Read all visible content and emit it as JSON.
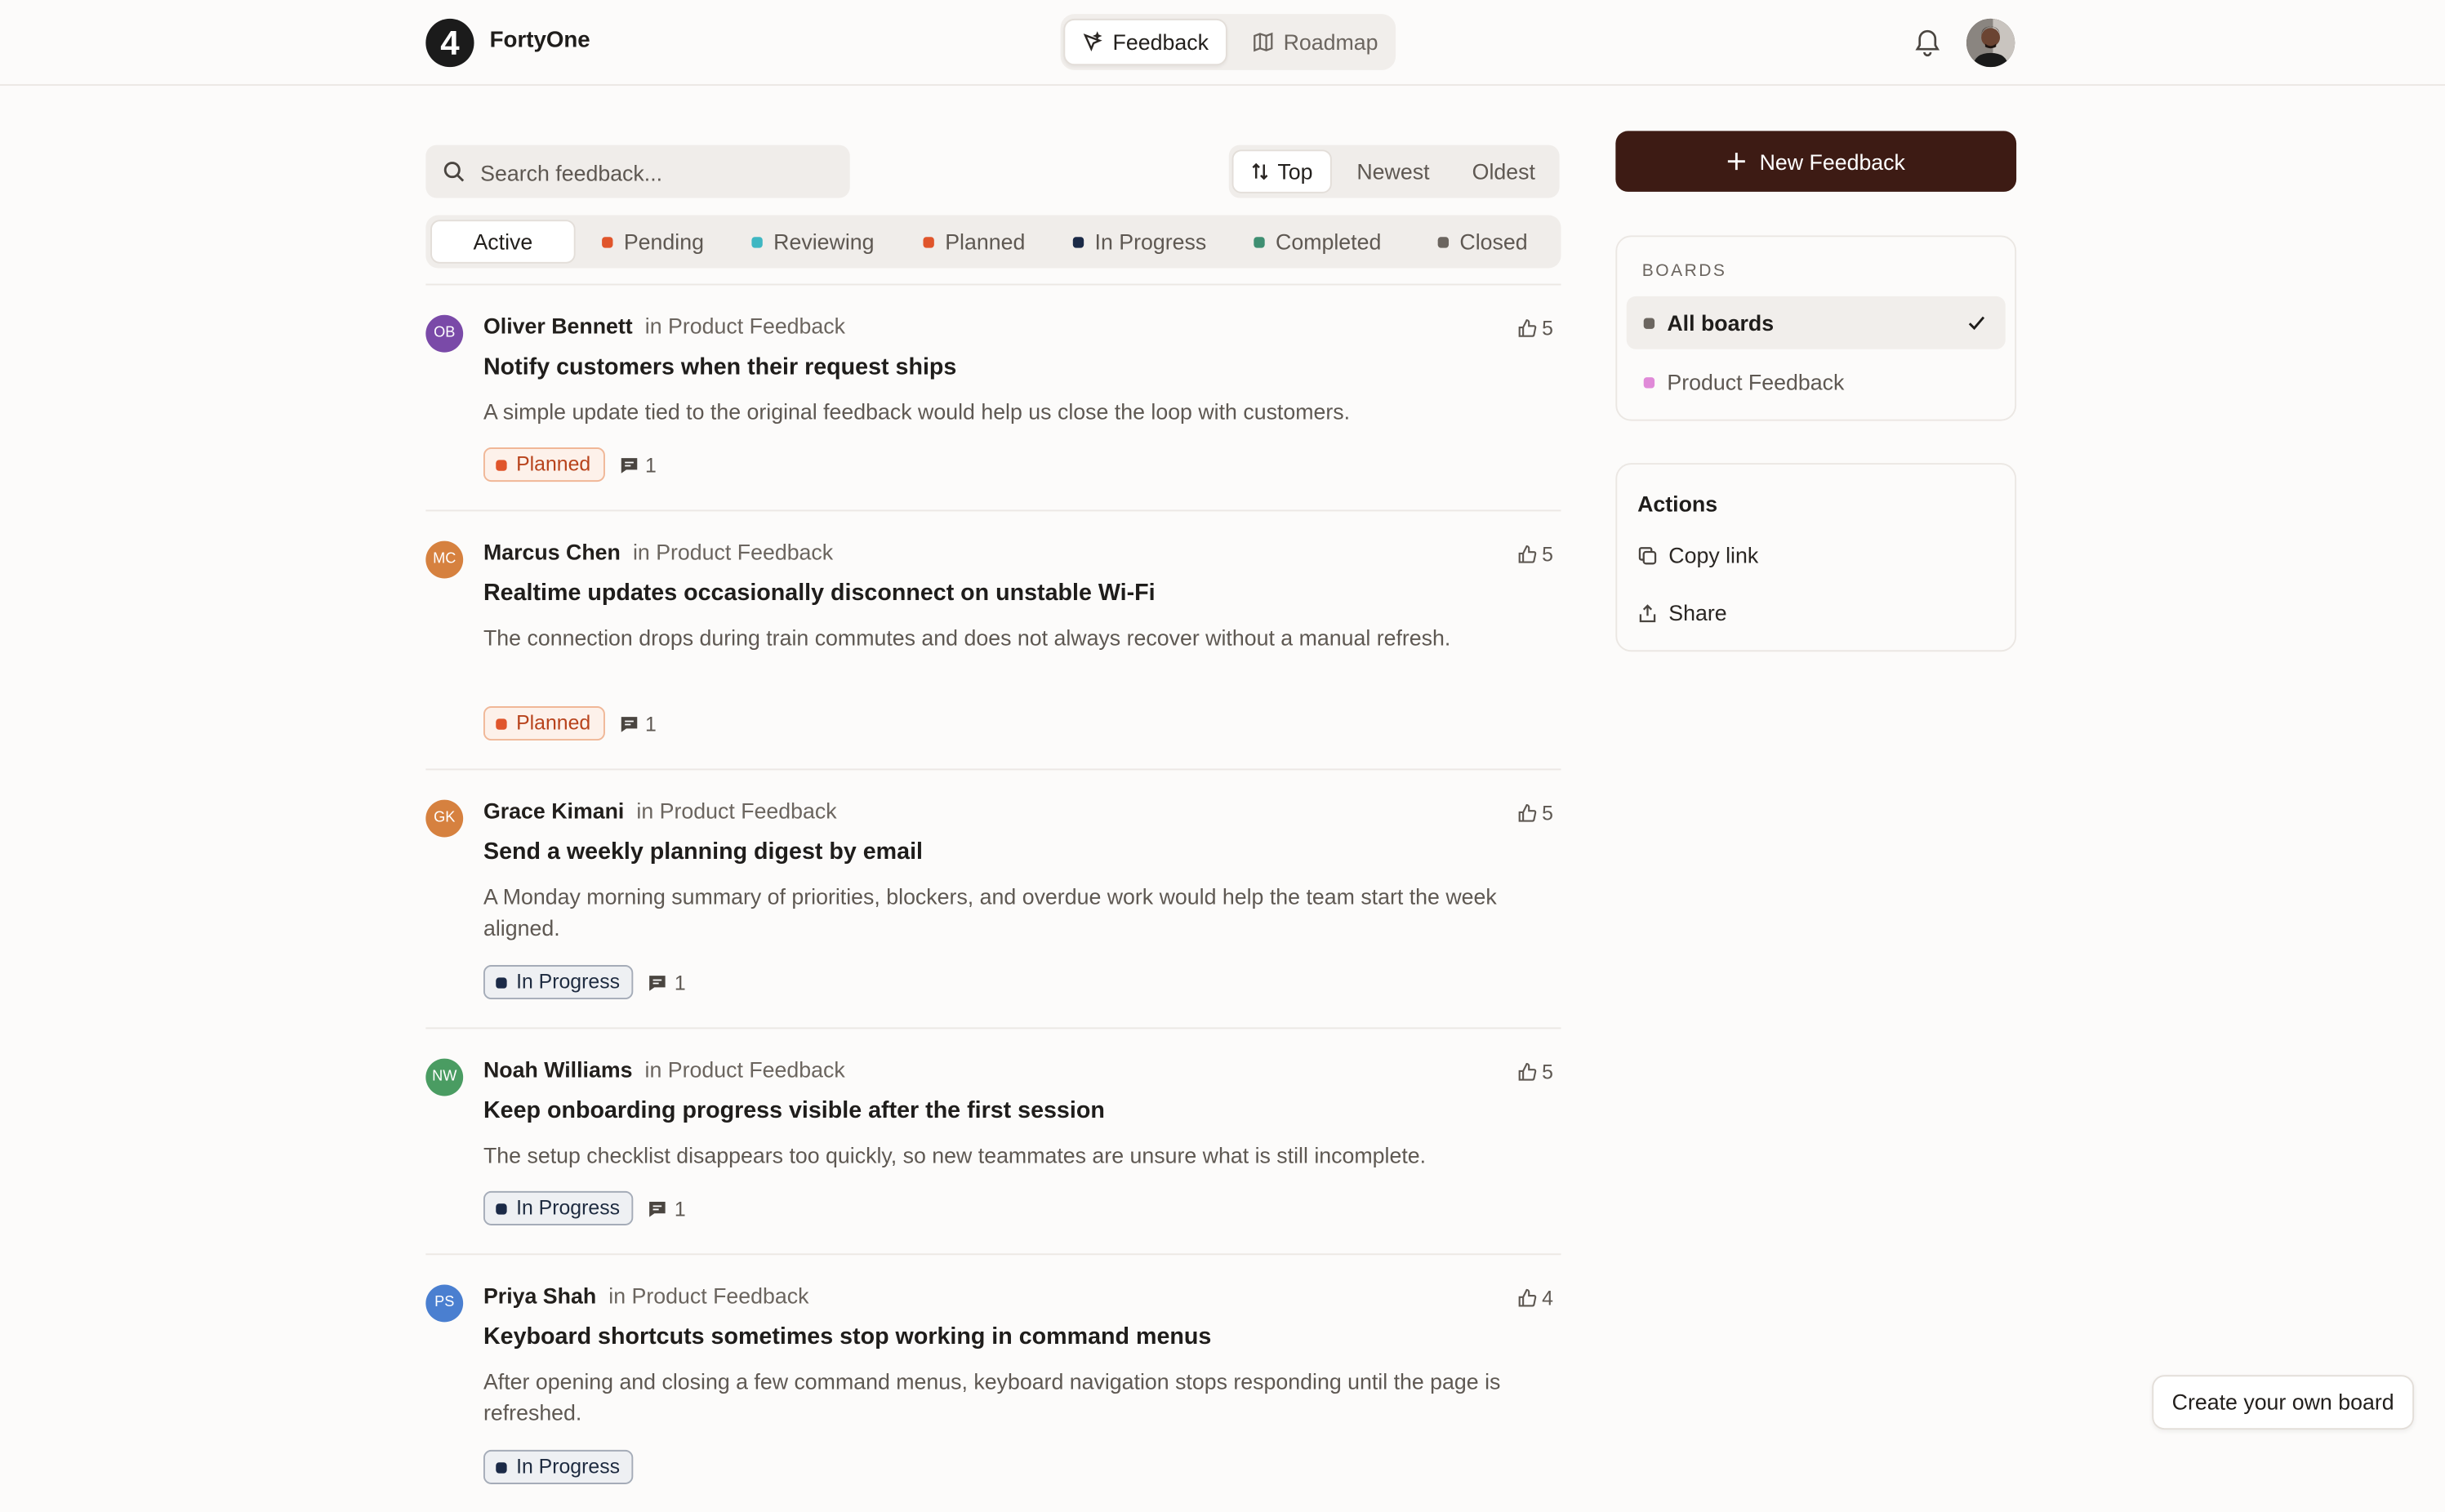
{
  "app": {
    "brand": "FortyOne",
    "logo_glyph": "4",
    "nav": [
      {
        "label": "Feedback",
        "icon": "feedback-icon",
        "active": true
      },
      {
        "label": "Roadmap",
        "icon": "map-icon",
        "active": false
      }
    ]
  },
  "search": {
    "placeholder": "Search feedback...",
    "value": ""
  },
  "sort": [
    {
      "label": "Top",
      "active": true
    },
    {
      "label": "Newest",
      "active": false
    },
    {
      "label": "Oldest",
      "active": false
    }
  ],
  "filters": [
    {
      "label": "Active",
      "color": "",
      "active": true
    },
    {
      "label": "Pending",
      "color": "#e0552b"
    },
    {
      "label": "Reviewing",
      "color": "#3fb7c2"
    },
    {
      "label": "Planned",
      "color": "#e0552b"
    },
    {
      "label": "In Progress",
      "color": "#1b2a47"
    },
    {
      "label": "Completed",
      "color": "#3f8f72"
    },
    {
      "label": "Closed",
      "color": "#6b655f"
    }
  ],
  "preposition": "in",
  "feedback": [
    {
      "initials": "OB",
      "avatar_color": "#7a4aa8",
      "author": "Oliver Bennett",
      "board": "Product Feedback",
      "votes": "5",
      "title": "Notify customers when their request ships",
      "description": "A simple update tied to the original feedback would help us close the loop with customers.",
      "status": "Planned",
      "status_color": "#e0552b",
      "comments": "1"
    },
    {
      "initials": "MC",
      "avatar_color": "#d6813f",
      "author": "Marcus Chen",
      "board": "Product Feedback",
      "votes": "5",
      "title": "Realtime updates occasionally disconnect on unstable Wi-Fi",
      "description": "The connection drops during train commutes and does not always recover without a manual refresh.",
      "status": "Planned",
      "status_color": "#e0552b",
      "comments": "1"
    },
    {
      "initials": "GK",
      "avatar_color": "#d6813f",
      "author": "Grace Kimani",
      "board": "Product Feedback",
      "votes": "5",
      "title": "Send a weekly planning digest by email",
      "description": "A Monday morning summary of priorities, blockers, and overdue work would help the team start the week aligned.",
      "status": "In Progress",
      "status_color": "#1b2a47",
      "comments": "1"
    },
    {
      "initials": "NW",
      "avatar_color": "#4a9c62",
      "author": "Noah Williams",
      "board": "Product Feedback",
      "votes": "5",
      "title": "Keep onboarding progress visible after the first session",
      "description": "The setup checklist disappears too quickly, so new teammates are unsure what is still incomplete.",
      "status": "In Progress",
      "status_color": "#1b2a47",
      "comments": "1"
    },
    {
      "initials": "PS",
      "avatar_color": "#4a7fd0",
      "author": "Priya Shah",
      "board": "Product Feedback",
      "votes": "4",
      "title": "Keyboard shortcuts sometimes stop working in command menus",
      "description": "After opening and closing a few command menus, keyboard navigation stops responding until the page is refreshed.",
      "status": "In Progress",
      "status_color": "#1b2a47",
      "comments": ""
    }
  ],
  "sidebar": {
    "new_button": "New Feedback",
    "boards_label": "BOARDS",
    "boards": [
      {
        "label": "All boards",
        "color": "#6b655f",
        "selected": true
      },
      {
        "label": "Product Feedback",
        "color": "#e08ad8",
        "selected": false
      }
    ],
    "actions_title": "Actions",
    "actions": [
      {
        "label": "Copy link",
        "icon": "copy-icon"
      },
      {
        "label": "Share",
        "icon": "share-icon"
      }
    ]
  },
  "footer": {
    "create_board": "Create your own board"
  }
}
